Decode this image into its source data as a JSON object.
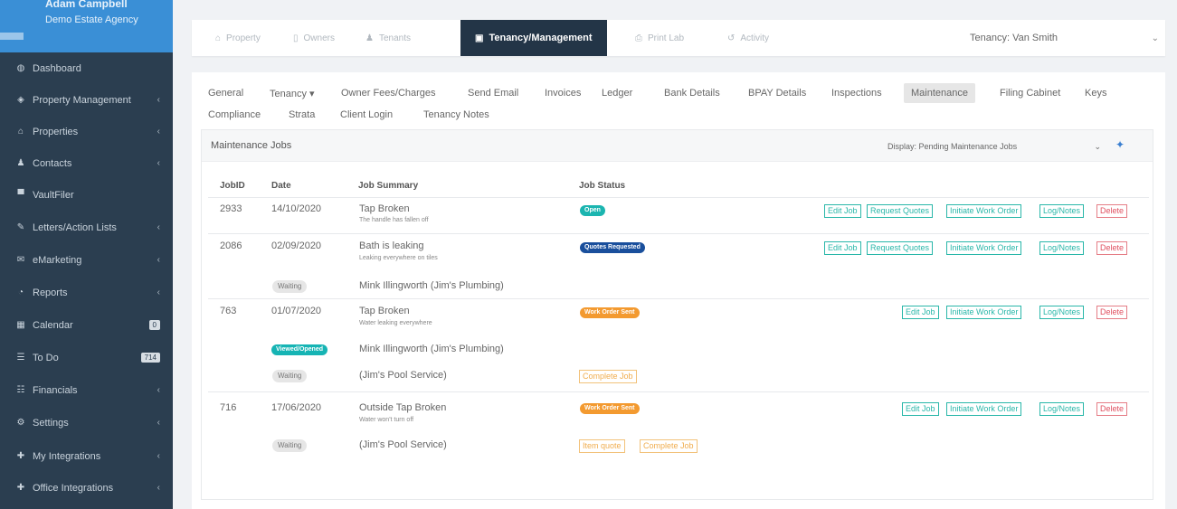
{
  "sidebar": {
    "user_name": "Adam Campbell",
    "agency_name": "Demo Estate Agency",
    "items": [
      {
        "label": "Dashboard",
        "icon": "dashboard-icon",
        "glyph": "◍",
        "chevron": ""
      },
      {
        "label": "Property Management",
        "icon": "shield-icon",
        "glyph": "◈",
        "chevron": "‹"
      },
      {
        "label": "Properties",
        "icon": "buildings-icon",
        "glyph": "⌂",
        "chevron": "‹"
      },
      {
        "label": "Contacts",
        "icon": "person-icon",
        "glyph": "♟",
        "chevron": "‹"
      },
      {
        "label": "VaultFiler",
        "icon": "vault-icon",
        "glyph": "▀",
        "chevron": ""
      },
      {
        "label": "Letters/Action Lists",
        "icon": "edit-icon",
        "glyph": "✎",
        "chevron": "‹"
      },
      {
        "label": "eMarketing",
        "icon": "envelope-icon",
        "glyph": "✉",
        "chevron": "‹"
      },
      {
        "label": "Reports",
        "icon": "pie-chart-icon",
        "glyph": "◔",
        "chevron": "‹"
      },
      {
        "label": "Calendar",
        "icon": "calendar-icon",
        "glyph": "▦",
        "badge": "0"
      },
      {
        "label": "To Do",
        "icon": "list-icon",
        "glyph": "☰",
        "badge": "714"
      },
      {
        "label": "Financials",
        "icon": "table-icon",
        "glyph": "☷",
        "chevron": "‹"
      },
      {
        "label": "Settings",
        "icon": "cogs-icon",
        "glyph": "⚙",
        "chevron": "‹"
      },
      {
        "label": "My Integrations",
        "icon": "plug-icon",
        "glyph": "✚",
        "chevron": "‹"
      },
      {
        "label": "Office Integrations",
        "icon": "plug-icon",
        "glyph": "✚",
        "chevron": "‹"
      }
    ]
  },
  "top_tabs": [
    {
      "label": "Property",
      "icon": "buildings-icon",
      "glyph": "⌂"
    },
    {
      "label": "Owners",
      "icon": "file-icon",
      "glyph": "▯"
    },
    {
      "label": "Tenants",
      "icon": "users-icon",
      "glyph": "♟"
    },
    {
      "label": "Tenancy/Management",
      "icon": "building-icon",
      "glyph": "▣"
    },
    {
      "label": "Print Lab",
      "icon": "print-icon",
      "glyph": "⎙"
    },
    {
      "label": "Activity",
      "icon": "history-icon",
      "glyph": "↺"
    }
  ],
  "tenancy_select": "Tenancy: Van Smith",
  "sub_tabs_row1": [
    "General",
    "Tenancy ▾",
    "Owner Fees/Charges",
    "Send Email",
    "Invoices",
    "Ledger",
    "Bank Details",
    "BPAY Details",
    "Inspections",
    "Maintenance",
    "Filing Cabinet",
    "Keys"
  ],
  "sub_tabs_row2": [
    "Compliance",
    "Strata",
    "Client Login",
    "Tenancy Notes"
  ],
  "maintenance": {
    "title": "Maintenance Jobs",
    "display_select": "Display: Pending Maintenance Jobs",
    "columns": [
      "JobID",
      "Date",
      "Job Summary",
      "Job Status"
    ],
    "jobs": [
      {
        "id": "2933",
        "date": "14/10/2020",
        "summary": "Tap Broken",
        "desc": "The handle has fallen off",
        "status": "Open"
      },
      {
        "id": "2086",
        "date": "02/09/2020",
        "summary": "Bath is leaking",
        "desc": "Leaking everywhere on tiles",
        "status": "Quotes Requested"
      },
      {
        "id": "763",
        "date": "01/07/2020",
        "summary": "Tap Broken",
        "desc": "Water leaking everywhere",
        "status": "Work Order Sent"
      },
      {
        "id": "716",
        "date": "17/06/2020",
        "summary": "Outside Tap Broken",
        "desc": "Water won't turn off",
        "status": "Work Order Sent"
      }
    ],
    "contractors": [
      {
        "badge": "Waiting",
        "name": "Mink Illingworth (Jim's Plumbing)"
      },
      {
        "badge": "Viewed/Opened",
        "name": "Mink Illingworth (Jim's Plumbing)"
      },
      {
        "badge": "Waiting",
        "name": "(Jim's Pool Service)"
      },
      {
        "badge": "Waiting",
        "name": "(Jim's Pool Service)"
      }
    ],
    "buttons": {
      "edit": "Edit Job",
      "request_quotes": "Request Quotes",
      "initiate_wo": "Initiate Work Order",
      "log_notes": "Log/Notes",
      "delete": "Delete",
      "complete_job": "Complete Job",
      "item_unclear": "Item quote"
    }
  }
}
